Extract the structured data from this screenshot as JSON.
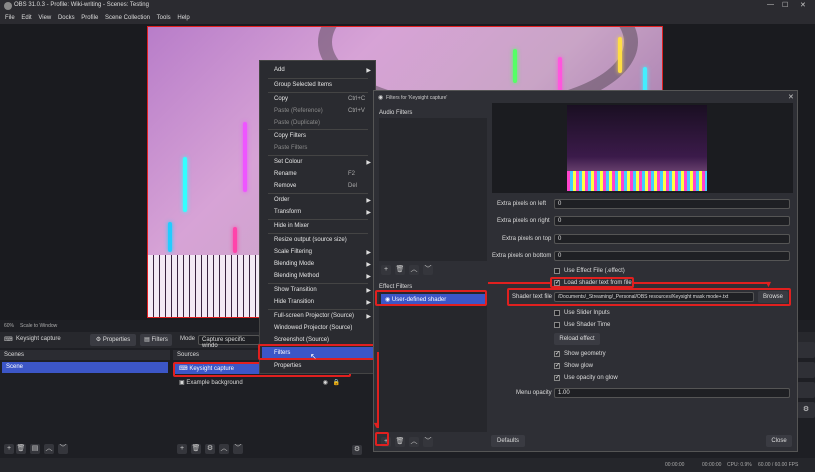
{
  "window": {
    "title": "OBS 31.0.3 - Profile: Wiki-writing - Scenes: Testing"
  },
  "menu": [
    "File",
    "Edit",
    "View",
    "Docks",
    "Profile",
    "Scene Collection",
    "Tools",
    "Help"
  ],
  "preview": {
    "zoom_label": "60%",
    "scale_label": "Scale to Window"
  },
  "source_bar": {
    "source_name": "Keysight capture",
    "properties_label": "Properties",
    "filters_label": "Filters",
    "mode_label": "Mode",
    "mode_value": "Capture specific windo"
  },
  "scenes": {
    "title": "Scenes",
    "items": [
      "Scene"
    ]
  },
  "sources": {
    "title": "Sources",
    "items": [
      "Keysight capture",
      "Example background"
    ]
  },
  "context_menu": {
    "items": [
      {
        "label": "Add",
        "shortcut": "",
        "submenu": true,
        "disabled": false
      },
      {
        "label": "Group Selected Items",
        "shortcut": "",
        "submenu": false,
        "disabled": false
      },
      {
        "label": "Copy",
        "shortcut": "Ctrl+C",
        "submenu": false,
        "disabled": false
      },
      {
        "label": "Paste (Reference)",
        "shortcut": "Ctrl+V",
        "submenu": false,
        "disabled": true
      },
      {
        "label": "Paste (Duplicate)",
        "shortcut": "",
        "submenu": false,
        "disabled": true
      },
      {
        "label": "Copy Filters",
        "shortcut": "",
        "submenu": false,
        "disabled": false
      },
      {
        "label": "Paste Filters",
        "shortcut": "",
        "submenu": false,
        "disabled": true
      },
      {
        "label": "Set Colour",
        "shortcut": "",
        "submenu": true,
        "disabled": false
      },
      {
        "label": "Rename",
        "shortcut": "F2",
        "submenu": false,
        "disabled": false
      },
      {
        "label": "Remove",
        "shortcut": "Del",
        "submenu": false,
        "disabled": false
      },
      {
        "label": "Order",
        "shortcut": "",
        "submenu": true,
        "disabled": false
      },
      {
        "label": "Transform",
        "shortcut": "",
        "submenu": true,
        "disabled": false
      },
      {
        "label": "Hide in Mixer",
        "shortcut": "",
        "submenu": false,
        "disabled": false
      },
      {
        "label": "Resize output (source size)",
        "shortcut": "",
        "submenu": false,
        "disabled": false
      },
      {
        "label": "Scale Filtering",
        "shortcut": "",
        "submenu": true,
        "disabled": false
      },
      {
        "label": "Blending Mode",
        "shortcut": "",
        "submenu": true,
        "disabled": false
      },
      {
        "label": "Blending Method",
        "shortcut": "",
        "submenu": true,
        "disabled": false
      },
      {
        "label": "Show Transition",
        "shortcut": "",
        "submenu": true,
        "disabled": false
      },
      {
        "label": "Hide Transition",
        "shortcut": "",
        "submenu": true,
        "disabled": false
      },
      {
        "label": "Full-screen Projector (Source)",
        "shortcut": "",
        "submenu": true,
        "disabled": false
      },
      {
        "label": "Windowed Projector (Source)",
        "shortcut": "",
        "submenu": false,
        "disabled": false
      },
      {
        "label": "Screenshot (Source)",
        "shortcut": "",
        "submenu": false,
        "disabled": false
      },
      {
        "label": "Filters",
        "shortcut": "",
        "submenu": false,
        "disabled": false
      },
      {
        "label": "Properties",
        "shortcut": "",
        "submenu": false,
        "disabled": false
      }
    ]
  },
  "filters_dialog": {
    "title": "Filters for 'Keysight capture'",
    "audio_filters_label": "Audio Filters",
    "effect_filters_label": "Effect Filters",
    "effect_filter_item": "User-defined shader",
    "fields": [
      {
        "label": "Extra pixels on left",
        "value": "0"
      },
      {
        "label": "Extra pixels on right",
        "value": "0"
      },
      {
        "label": "Extra pixels on top",
        "value": "0"
      },
      {
        "label": "Extra pixels on bottom",
        "value": "0"
      }
    ],
    "use_effect_file": "Use Effect File (.effect)",
    "load_shader_text": "Load shader text from file",
    "shader_text_file_label": "Shader text file",
    "shader_text_file_value": "/Documents/_Streaming/_Personal/OBS resources/Keysight mask mode+.txt",
    "browse_label": "Browse",
    "use_slider_inputs": "Use Slider Inputs",
    "use_shader_time": "Use Shader Time",
    "reload_effect": "Reload effect",
    "show_geometry": "Show geometry",
    "show_glow": "Show glow",
    "use_opacity_on_glow": "Use opacity on glow",
    "menu_opacity_label": "Menu opacity",
    "menu_opacity_value": "1.00",
    "defaults_label": "Defaults",
    "close_label": "Close"
  },
  "status": {
    "time": "00:00:00",
    "time2": "00:00:00",
    "cpu": "CPU: 0.9%",
    "fps": "60.00 / 60.00 FPS"
  }
}
